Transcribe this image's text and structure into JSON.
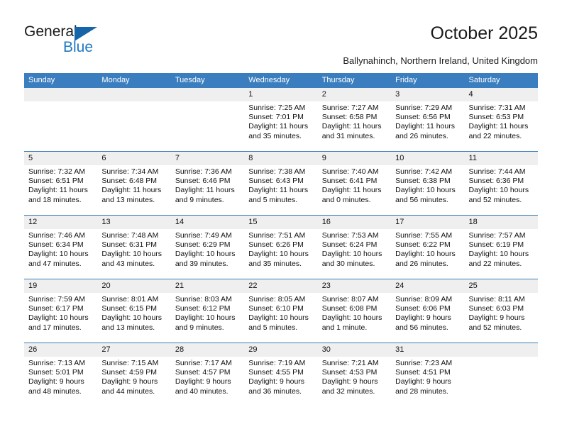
{
  "logo": {
    "word1": "General",
    "word2": "Blue",
    "triangle_color": "#1565a8",
    "word2_color": "#2079c4"
  },
  "header": {
    "title": "October 2025",
    "subtitle": "Ballynahinch, Northern Ireland, United Kingdom"
  },
  "colors": {
    "header_blue": "#3b7ebf",
    "date_band": "#efefef",
    "text": "#111111"
  },
  "weekdays": [
    "Sunday",
    "Monday",
    "Tuesday",
    "Wednesday",
    "Thursday",
    "Friday",
    "Saturday"
  ],
  "weeks": [
    [
      {
        "day": "",
        "sunrise": "",
        "sunset": "",
        "daylight": "",
        "empty": true
      },
      {
        "day": "",
        "sunrise": "",
        "sunset": "",
        "daylight": "",
        "empty": true
      },
      {
        "day": "",
        "sunrise": "",
        "sunset": "",
        "daylight": "",
        "empty": true
      },
      {
        "day": "1",
        "sunrise": "Sunrise: 7:25 AM",
        "sunset": "Sunset: 7:01 PM",
        "daylight": "Daylight: 11 hours and 35 minutes."
      },
      {
        "day": "2",
        "sunrise": "Sunrise: 7:27 AM",
        "sunset": "Sunset: 6:58 PM",
        "daylight": "Daylight: 11 hours and 31 minutes."
      },
      {
        "day": "3",
        "sunrise": "Sunrise: 7:29 AM",
        "sunset": "Sunset: 6:56 PM",
        "daylight": "Daylight: 11 hours and 26 minutes."
      },
      {
        "day": "4",
        "sunrise": "Sunrise: 7:31 AM",
        "sunset": "Sunset: 6:53 PM",
        "daylight": "Daylight: 11 hours and 22 minutes."
      }
    ],
    [
      {
        "day": "5",
        "sunrise": "Sunrise: 7:32 AM",
        "sunset": "Sunset: 6:51 PM",
        "daylight": "Daylight: 11 hours and 18 minutes."
      },
      {
        "day": "6",
        "sunrise": "Sunrise: 7:34 AM",
        "sunset": "Sunset: 6:48 PM",
        "daylight": "Daylight: 11 hours and 13 minutes."
      },
      {
        "day": "7",
        "sunrise": "Sunrise: 7:36 AM",
        "sunset": "Sunset: 6:46 PM",
        "daylight": "Daylight: 11 hours and 9 minutes."
      },
      {
        "day": "8",
        "sunrise": "Sunrise: 7:38 AM",
        "sunset": "Sunset: 6:43 PM",
        "daylight": "Daylight: 11 hours and 5 minutes."
      },
      {
        "day": "9",
        "sunrise": "Sunrise: 7:40 AM",
        "sunset": "Sunset: 6:41 PM",
        "daylight": "Daylight: 11 hours and 0 minutes."
      },
      {
        "day": "10",
        "sunrise": "Sunrise: 7:42 AM",
        "sunset": "Sunset: 6:38 PM",
        "daylight": "Daylight: 10 hours and 56 minutes."
      },
      {
        "day": "11",
        "sunrise": "Sunrise: 7:44 AM",
        "sunset": "Sunset: 6:36 PM",
        "daylight": "Daylight: 10 hours and 52 minutes."
      }
    ],
    [
      {
        "day": "12",
        "sunrise": "Sunrise: 7:46 AM",
        "sunset": "Sunset: 6:34 PM",
        "daylight": "Daylight: 10 hours and 47 minutes."
      },
      {
        "day": "13",
        "sunrise": "Sunrise: 7:48 AM",
        "sunset": "Sunset: 6:31 PM",
        "daylight": "Daylight: 10 hours and 43 minutes."
      },
      {
        "day": "14",
        "sunrise": "Sunrise: 7:49 AM",
        "sunset": "Sunset: 6:29 PM",
        "daylight": "Daylight: 10 hours and 39 minutes."
      },
      {
        "day": "15",
        "sunrise": "Sunrise: 7:51 AM",
        "sunset": "Sunset: 6:26 PM",
        "daylight": "Daylight: 10 hours and 35 minutes."
      },
      {
        "day": "16",
        "sunrise": "Sunrise: 7:53 AM",
        "sunset": "Sunset: 6:24 PM",
        "daylight": "Daylight: 10 hours and 30 minutes."
      },
      {
        "day": "17",
        "sunrise": "Sunrise: 7:55 AM",
        "sunset": "Sunset: 6:22 PM",
        "daylight": "Daylight: 10 hours and 26 minutes."
      },
      {
        "day": "18",
        "sunrise": "Sunrise: 7:57 AM",
        "sunset": "Sunset: 6:19 PM",
        "daylight": "Daylight: 10 hours and 22 minutes."
      }
    ],
    [
      {
        "day": "19",
        "sunrise": "Sunrise: 7:59 AM",
        "sunset": "Sunset: 6:17 PM",
        "daylight": "Daylight: 10 hours and 17 minutes."
      },
      {
        "day": "20",
        "sunrise": "Sunrise: 8:01 AM",
        "sunset": "Sunset: 6:15 PM",
        "daylight": "Daylight: 10 hours and 13 minutes."
      },
      {
        "day": "21",
        "sunrise": "Sunrise: 8:03 AM",
        "sunset": "Sunset: 6:12 PM",
        "daylight": "Daylight: 10 hours and 9 minutes."
      },
      {
        "day": "22",
        "sunrise": "Sunrise: 8:05 AM",
        "sunset": "Sunset: 6:10 PM",
        "daylight": "Daylight: 10 hours and 5 minutes."
      },
      {
        "day": "23",
        "sunrise": "Sunrise: 8:07 AM",
        "sunset": "Sunset: 6:08 PM",
        "daylight": "Daylight: 10 hours and 1 minute."
      },
      {
        "day": "24",
        "sunrise": "Sunrise: 8:09 AM",
        "sunset": "Sunset: 6:06 PM",
        "daylight": "Daylight: 9 hours and 56 minutes."
      },
      {
        "day": "25",
        "sunrise": "Sunrise: 8:11 AM",
        "sunset": "Sunset: 6:03 PM",
        "daylight": "Daylight: 9 hours and 52 minutes."
      }
    ],
    [
      {
        "day": "26",
        "sunrise": "Sunrise: 7:13 AM",
        "sunset": "Sunset: 5:01 PM",
        "daylight": "Daylight: 9 hours and 48 minutes."
      },
      {
        "day": "27",
        "sunrise": "Sunrise: 7:15 AM",
        "sunset": "Sunset: 4:59 PM",
        "daylight": "Daylight: 9 hours and 44 minutes."
      },
      {
        "day": "28",
        "sunrise": "Sunrise: 7:17 AM",
        "sunset": "Sunset: 4:57 PM",
        "daylight": "Daylight: 9 hours and 40 minutes."
      },
      {
        "day": "29",
        "sunrise": "Sunrise: 7:19 AM",
        "sunset": "Sunset: 4:55 PM",
        "daylight": "Daylight: 9 hours and 36 minutes."
      },
      {
        "day": "30",
        "sunrise": "Sunrise: 7:21 AM",
        "sunset": "Sunset: 4:53 PM",
        "daylight": "Daylight: 9 hours and 32 minutes."
      },
      {
        "day": "31",
        "sunrise": "Sunrise: 7:23 AM",
        "sunset": "Sunset: 4:51 PM",
        "daylight": "Daylight: 9 hours and 28 minutes."
      },
      {
        "day": "",
        "sunrise": "",
        "sunset": "",
        "daylight": "",
        "empty": true
      }
    ]
  ]
}
